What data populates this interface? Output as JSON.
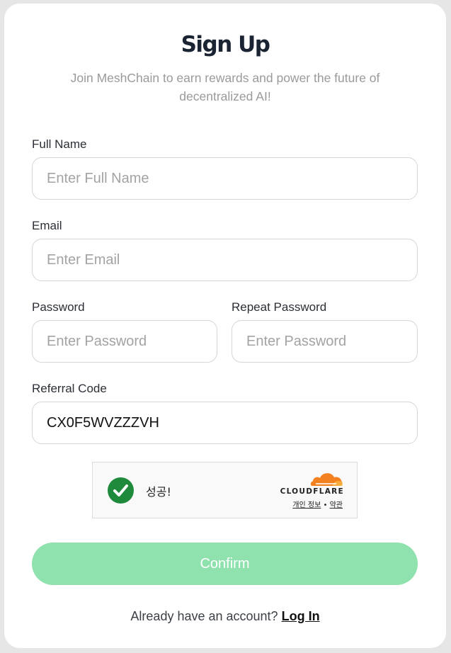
{
  "header": {
    "title": "Sign Up",
    "subtitle": "Join MeshChain to earn rewards and power the future of decentralized AI!"
  },
  "form": {
    "full_name": {
      "label": "Full Name",
      "placeholder": "Enter Full Name",
      "value": ""
    },
    "email": {
      "label": "Email",
      "placeholder": "Enter Email",
      "value": ""
    },
    "password": {
      "label": "Password",
      "placeholder": "Enter Password",
      "value": ""
    },
    "repeat_password": {
      "label": "Repeat Password",
      "placeholder": "Enter Password",
      "value": ""
    },
    "referral_code": {
      "label": "Referral Code",
      "placeholder": "",
      "value": "CX0F5WVZZZVH"
    }
  },
  "captcha": {
    "status_text": "성공!",
    "status_icon": "checkmark-icon",
    "brand": "CLOUDFLARE",
    "privacy_link": "개인 정보",
    "separator": "•",
    "terms_link": "약관",
    "colors": {
      "success": "#1f8a3b",
      "brand_orange": "#f48120",
      "brand_orange_light": "#faad3f"
    }
  },
  "actions": {
    "confirm_label": "Confirm"
  },
  "footer": {
    "prompt": "Already have an account?",
    "login_label": "Log In"
  },
  "colors": {
    "background": "#e6e6e6",
    "card": "#ffffff",
    "title": "#1b2433",
    "button": "#8fe1ad"
  }
}
